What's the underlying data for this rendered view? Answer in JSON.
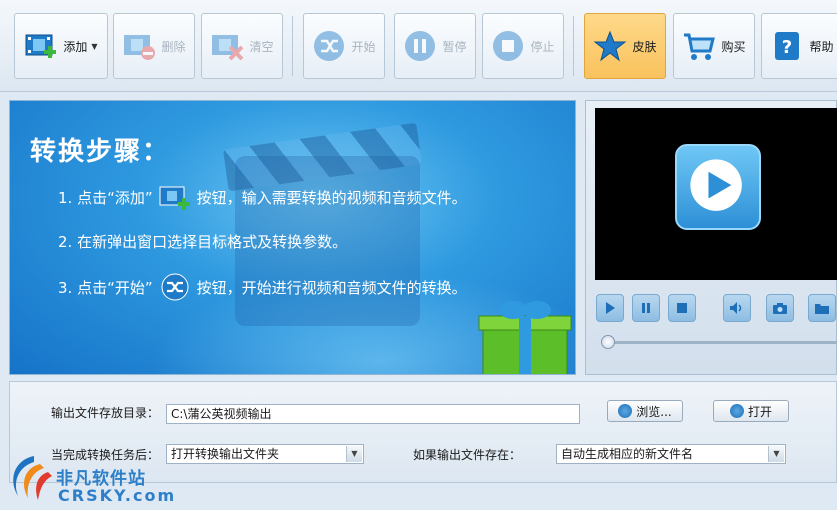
{
  "toolbar": {
    "add": "添加",
    "delete": "删除",
    "clear": "清空",
    "start": "开始",
    "pause": "暂停",
    "stop": "停止",
    "skin": "皮肤",
    "buy": "购买",
    "help": "帮助"
  },
  "banner": {
    "title": "转换步骤：",
    "step1_a": "1. 点击“添加”",
    "step1_b": "按钮，输入需要转换的视频和音频文件。",
    "step2": "2. 在新弹出窗口选择目标格式及转换参数。",
    "step3_a": "3. 点击“开始”",
    "step3_b": "按钮，开始进行视频和音频文件的转换。"
  },
  "settings": {
    "output_dir_label": "输出文件存放目录：",
    "output_dir_value": "C:\\蒲公英视频输出",
    "browse": "浏览...",
    "open": "打开",
    "after_done_label": "当完成转换任务后：",
    "after_done_value": "打开转换输出文件夹",
    "if_exists_label": "如果输出文件存在：",
    "if_exists_value": "自动生成相应的新文件名"
  },
  "watermark": {
    "cn": "非凡软件站",
    "en": "CRSKY.com"
  },
  "colors": {
    "accent": "#2f9ae0",
    "skin_active": "#f9c25d"
  }
}
